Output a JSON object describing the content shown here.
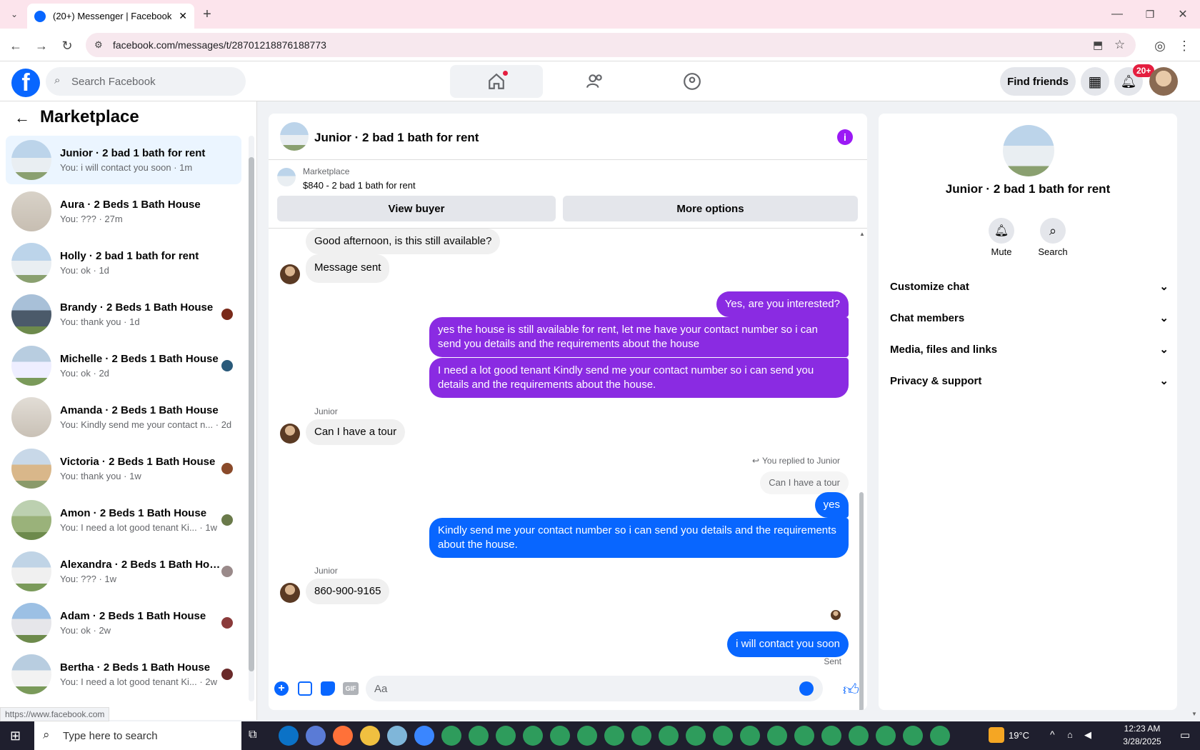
{
  "browser": {
    "tab_title": "(20+) Messenger | Facebook",
    "url": "facebook.com/messages/t/28701218876188773",
    "status_url": "https://www.facebook.com"
  },
  "fb": {
    "search_placeholder": "Search Facebook",
    "find_friends": "Find friends",
    "notif_badge": "20+"
  },
  "left": {
    "title": "Marketplace",
    "conversations": [
      {
        "name": "Junior · 2 bad 1 bath for rent",
        "sub": "You: i will contact you soon · 1m"
      },
      {
        "name": "Aura · 2 Beds 1 Bath House",
        "sub": "You: ??? · 27m"
      },
      {
        "name": "Holly · 2 bad 1 bath for rent",
        "sub": "You: ok · 1d"
      },
      {
        "name": "Brandy · 2 Beds 1 Bath House",
        "sub": "You: thank you · 1d"
      },
      {
        "name": "Michelle · 2 Beds 1 Bath House",
        "sub": "You: ok · 2d"
      },
      {
        "name": "Amanda · 2 Beds 1 Bath House",
        "sub": "You: Kindly send me your contact n... · 2d"
      },
      {
        "name": "Victoria · 2 Beds 1 Bath House",
        "sub": "You: thank you · 1w"
      },
      {
        "name": "Amon · 2 Beds 1 Bath House",
        "sub": "You: I need a lot good tenant Ki... · 1w"
      },
      {
        "name": "Alexandra · 2 Beds 1 Bath Hou...",
        "sub": "You: ??? · 1w"
      },
      {
        "name": "Adam · 2 Beds 1 Bath House",
        "sub": "You: ok · 2w"
      },
      {
        "name": "Bertha · 2 Beds 1 Bath House",
        "sub": "You: I need a lot good tenant Ki... · 2w"
      }
    ]
  },
  "chat": {
    "title": "Junior · 2 bad 1 bath for rent",
    "mp_label": "Marketplace",
    "listing": "$840 - 2 bad 1 bath for rent",
    "view_buyer": "View buyer",
    "more_options": "More options",
    "m1": "Good afternoon, is this still available?",
    "m2": "Message sent",
    "m3": "Yes, are you interested?",
    "m4": "yes the house is still available for rent, let me have your contact number so i can send you details and the requirements about the house",
    "m5": "I need a lot good tenant Kindly send me your contact number so i can send you details and the requirements about the house.",
    "sender": "Junior",
    "m6": "Can I have a tour",
    "reply_label": "You replied to Junior",
    "reply_quote": "Can I have a tour",
    "m7": "yes",
    "m8": "Kindly send me your contact number so i can send you details and the requirements about the house.",
    "m9": "860-900-9165",
    "m10": "i will contact you soon",
    "sent": "Sent",
    "composer_placeholder": "Aa",
    "gif": "GIF"
  },
  "info": {
    "title": "Junior · 2 bad 1 bath for rent",
    "mute": "Mute",
    "search": "Search",
    "sections": [
      "Customize chat",
      "Chat members",
      "Media, files and links",
      "Privacy & support"
    ]
  },
  "taskbar": {
    "search_placeholder": "Type here to search",
    "temp": "19°C",
    "time": "12:23 AM",
    "date": "3/28/2025"
  },
  "colors": {
    "fb_blue": "#0866ff",
    "purple": "#8a2be2",
    "active_row": "#ebf5ff"
  }
}
